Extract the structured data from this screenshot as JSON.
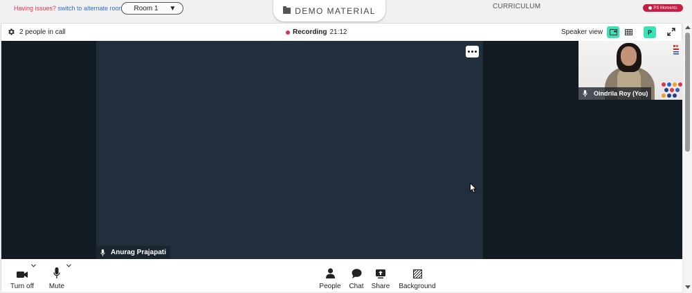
{
  "topbar": {
    "issues_text": "Having issues?",
    "switch_link": "switch to alternate room",
    "room_select": {
      "value": "Room 1",
      "caret": "▼"
    },
    "demo_material": "DEMO MATERIAL",
    "curriculum": "CURRICULUM",
    "ps_moments": "PS Moments"
  },
  "call_header": {
    "people_count": "2 people in call",
    "recording_label": "Recording",
    "recording_time": "21:12",
    "speaker_view": "Speaker view",
    "pip_label": "P"
  },
  "participants": {
    "main": {
      "name": "Anurag Prajapati"
    },
    "self": {
      "name": "Oindrila Roy (You)"
    }
  },
  "controls": {
    "turn_off": "Turn off",
    "mute": "Mute",
    "people": "People",
    "chat": "Chat",
    "share": "Share",
    "background": "Background"
  },
  "colors": {
    "accent_green": "#3be3b4",
    "record_red": "#d6334f",
    "stage_dark": "#121a22",
    "video_bg": "#212e3b",
    "ps_badge": "#c81e45"
  },
  "icons": [
    "gear-icon",
    "speaker-view-icon",
    "grid-view-icon",
    "expand-icon",
    "more-icon",
    "mic-icon",
    "camera-icon",
    "person-icon",
    "chat-icon",
    "share-icon",
    "background-icon",
    "folder-icon"
  ]
}
